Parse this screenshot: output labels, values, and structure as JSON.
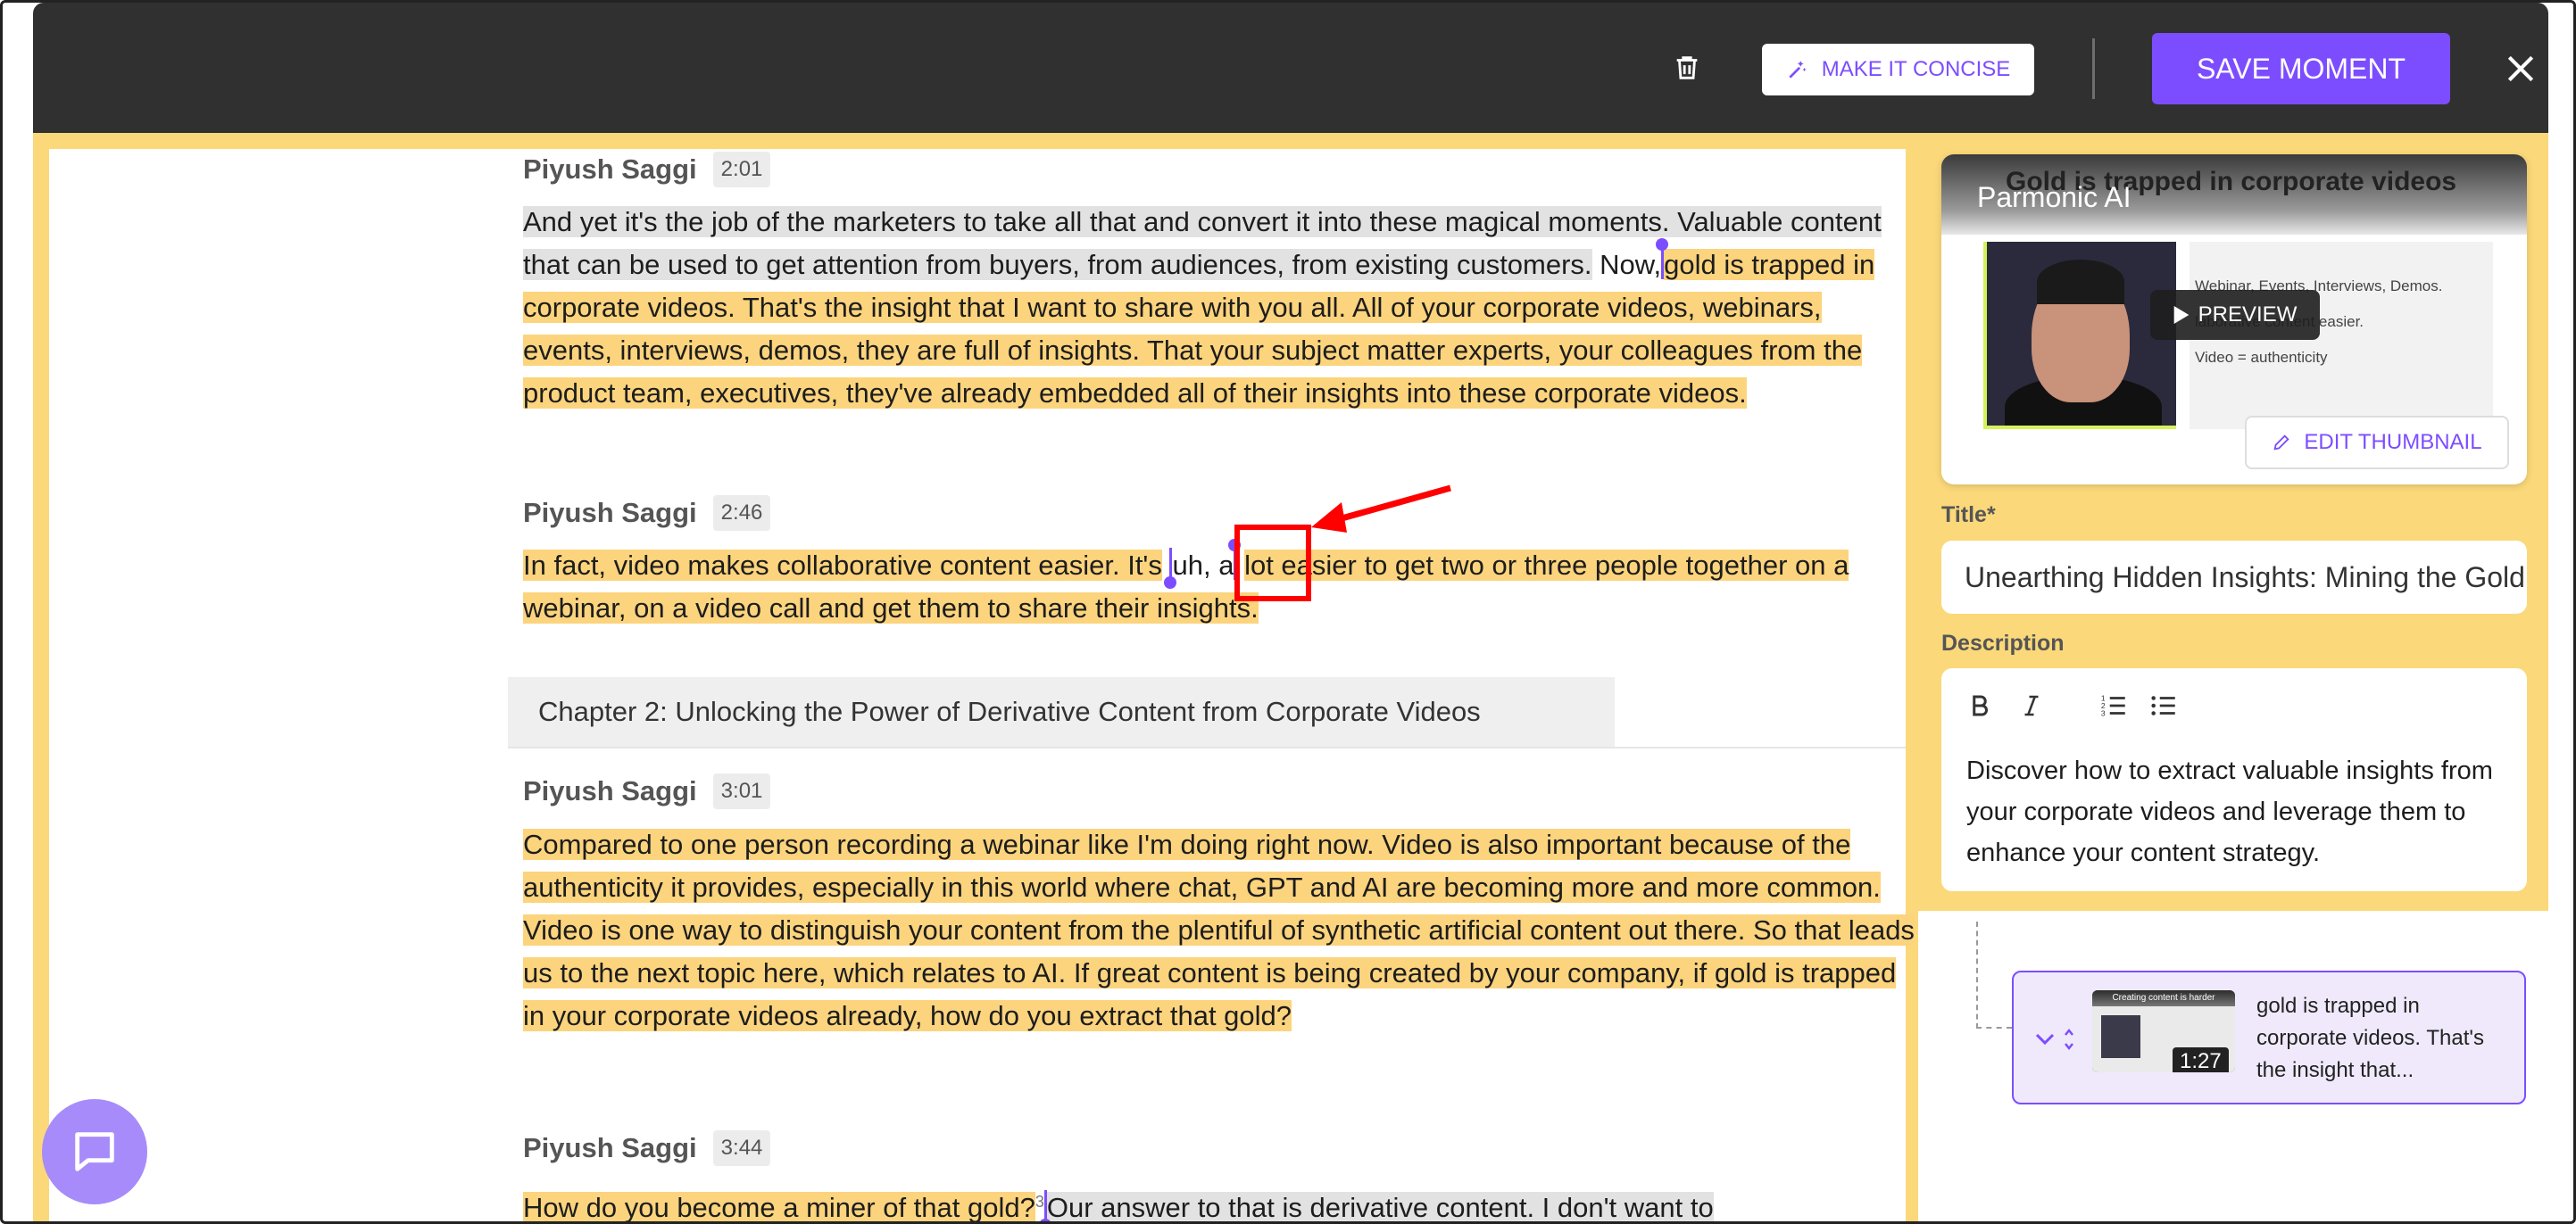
{
  "toolbar": {
    "concise_label": "MAKE IT CONCISE",
    "save_label": "SAVE MOMENT",
    "trash_icon": "trash-icon",
    "close_icon": "close-icon",
    "accent": "#7c4dff",
    "bar_color": "#303030"
  },
  "transcript": {
    "highlight_color": "#fcd47d",
    "blocks": [
      {
        "speaker": "Piyush Saggi",
        "time": "2:01",
        "gray_text": "And yet it's the job of the marketers to take all that and convert it into these magical moments. Valuable content that can be used to get attention from buyers, from audiences, from existing customers.",
        "white_text": "Now,",
        "highlight_text": "gold is trapped in corporate videos. That's the insight that I want to share with you all. All of your corporate videos, webinars, events, interviews, demos, they are full of insights. That your subject matter experts, your colleagues from the product team, executives, they've already embedded all of their insights into these corporate videos."
      },
      {
        "speaker": "Piyush Saggi",
        "time": "2:46",
        "highlight_before": "In fact, video makes collaborative content easier. It's",
        "white_text": "uh, a",
        "highlight_after": "lot easier to get two or three people together on a webinar, on a video call and get them to share their insights."
      },
      {
        "chapter": "Chapter 2: Unlocking the Power of Derivative Content from Corporate Videos"
      },
      {
        "speaker": "Piyush Saggi",
        "time": "3:01",
        "highlight_text": "Compared to one person recording a webinar like I'm doing right now. Video is also important because of the authenticity it provides, especially in this world where chat, GPT and AI are becoming more and more common. Video is one way to distinguish your content from the plentiful of synthetic artificial content out there. So that leads us to the next topic here, which relates to AI. If great content is being created by your company, if gold is trapped in your corporate videos already, how do you extract that gold?"
      },
      {
        "speaker": "Piyush Saggi",
        "time": "3:44",
        "highlight_text": "How do you become a miner of that gold?",
        "marker": "3",
        "gray_text": "Our answer to that is derivative content. I don't want to"
      }
    ]
  },
  "thumbnail": {
    "headline": "Gold is trapped in corporate videos",
    "brand": "Parmonic AI",
    "slide_lines": [
      "Webinar, Events, Interviews, Demos.",
      "laborative content easier.",
      "Video = authenticity"
    ],
    "preview_label": "PREVIEW",
    "edit_label": "EDIT THUMBNAIL"
  },
  "form": {
    "title_label": "Title*",
    "title_value": "Unearthing Hidden Insights: Mining the Gold",
    "description_label": "Description",
    "description_text": "Discover how to extract valuable insights from your corporate videos and leverage them to enhance your content strategy.",
    "toolbar_icons": [
      "bold-icon",
      "italic-icon",
      "ordered-list-icon",
      "bullet-list-icon"
    ]
  },
  "moment": {
    "thumb_head": "Creating content is harder",
    "duration": "1:27",
    "text": "gold is trapped in corporate videos. That's the insight that..."
  }
}
